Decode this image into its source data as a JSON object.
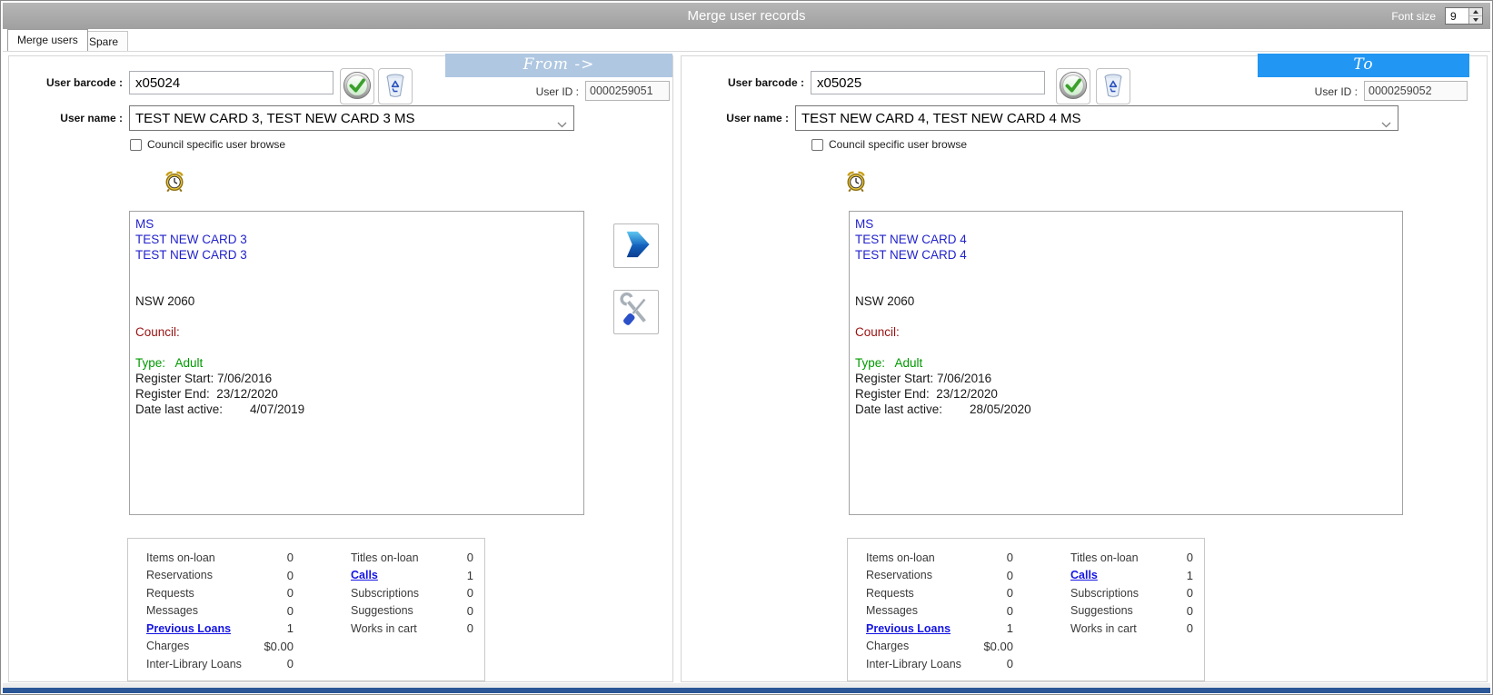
{
  "window": {
    "title": "Merge user records",
    "font_size_label": "Font size",
    "font_size_value": "9"
  },
  "tabs": {
    "merge_users": "Merge users",
    "spare": "Spare"
  },
  "colors": {
    "from_banner": "#afc7e1",
    "to_banner": "#2196f3",
    "bottom_bar": "#2b5797",
    "link": "#1414e6"
  },
  "from_panel": {
    "banner_label": "From ->",
    "user_barcode_label": "User barcode :",
    "user_barcode_value": "x05024",
    "user_id_label": "User ID :",
    "user_id_value": "0000259051",
    "user_name_label": "User name :",
    "user_name_value": "TEST NEW CARD 3, TEST NEW CARD 3 MS",
    "council_browse_label": "Council specific user browse",
    "details": [
      {
        "text": "MS",
        "color": "#2222cc"
      },
      {
        "text": "TEST NEW CARD 3",
        "color": "#2222cc"
      },
      {
        "text": "TEST NEW CARD 3",
        "color": "#2222cc"
      },
      {
        "text": "",
        "color": "#1a1a1a"
      },
      {
        "text": "",
        "color": "#1a1a1a"
      },
      {
        "text": "NSW 2060",
        "color": "#1a1a1a"
      },
      {
        "text": "",
        "color": "#1a1a1a"
      },
      {
        "text": "Council:",
        "color": "#991111"
      },
      {
        "text": "",
        "color": "#1a1a1a"
      },
      {
        "text": "Type:   Adult",
        "color": "#009900"
      },
      {
        "text": "Register Start: 7/06/2016",
        "color": "#1a1a1a"
      },
      {
        "text": "Register End:  23/12/2020",
        "color": "#1a1a1a"
      },
      {
        "text": "Date last active:        4/07/2019",
        "color": "#1a1a1a"
      }
    ],
    "stats_col1": [
      {
        "label": "Items on-loan",
        "value": "0",
        "link": false
      },
      {
        "label": "Reservations",
        "value": "0",
        "link": false
      },
      {
        "label": "Requests",
        "value": "0",
        "link": false
      },
      {
        "label": "Messages",
        "value": "0",
        "link": false
      },
      {
        "label": "Previous Loans",
        "value": "1",
        "link": true
      },
      {
        "label": "Charges",
        "value": "$0.00",
        "link": false
      },
      {
        "label": "Inter-Library Loans",
        "value": "0",
        "link": false
      }
    ],
    "stats_col2": [
      {
        "label": "Titles on-loan",
        "value": "0",
        "link": false
      },
      {
        "label": "Calls",
        "value": "1",
        "link": true
      },
      {
        "label": "Subscriptions",
        "value": "0",
        "link": false
      },
      {
        "label": "Suggestions",
        "value": "0",
        "link": false
      },
      {
        "label": "Works in cart",
        "value": "0",
        "link": false
      }
    ]
  },
  "to_panel": {
    "banner_label": "To",
    "user_barcode_label": "User barcode :",
    "user_barcode_value": "x05025",
    "user_id_label": "User ID :",
    "user_id_value": "0000259052",
    "user_name_label": "User name :",
    "user_name_value": "TEST NEW CARD 4, TEST NEW CARD 4 MS",
    "council_browse_label": "Council specific user browse",
    "details": [
      {
        "text": "MS",
        "color": "#2222cc"
      },
      {
        "text": "TEST NEW CARD 4",
        "color": "#2222cc"
      },
      {
        "text": "TEST NEW CARD 4",
        "color": "#2222cc"
      },
      {
        "text": "",
        "color": "#1a1a1a"
      },
      {
        "text": "",
        "color": "#1a1a1a"
      },
      {
        "text": "NSW 2060",
        "color": "#1a1a1a"
      },
      {
        "text": "",
        "color": "#1a1a1a"
      },
      {
        "text": "Council:",
        "color": "#991111"
      },
      {
        "text": "",
        "color": "#1a1a1a"
      },
      {
        "text": "Type:   Adult",
        "color": "#009900"
      },
      {
        "text": "Register Start: 7/06/2016",
        "color": "#1a1a1a"
      },
      {
        "text": "Register End:  23/12/2020",
        "color": "#1a1a1a"
      },
      {
        "text": "Date last active:        28/05/2020",
        "color": "#1a1a1a"
      }
    ],
    "stats_col1": [
      {
        "label": "Items on-loan",
        "value": "0",
        "link": false
      },
      {
        "label": "Reservations",
        "value": "0",
        "link": false
      },
      {
        "label": "Requests",
        "value": "0",
        "link": false
      },
      {
        "label": "Messages",
        "value": "0",
        "link": false
      },
      {
        "label": "Previous Loans",
        "value": "1",
        "link": true
      },
      {
        "label": "Charges",
        "value": "$0.00",
        "link": false
      },
      {
        "label": "Inter-Library Loans",
        "value": "0",
        "link": false
      }
    ],
    "stats_col2": [
      {
        "label": "Titles on-loan",
        "value": "0",
        "link": false
      },
      {
        "label": "Calls",
        "value": "1",
        "link": true
      },
      {
        "label": "Subscriptions",
        "value": "0",
        "link": false
      },
      {
        "label": "Suggestions",
        "value": "0",
        "link": false
      },
      {
        "label": "Works in cart",
        "value": "0",
        "link": false
      }
    ]
  }
}
